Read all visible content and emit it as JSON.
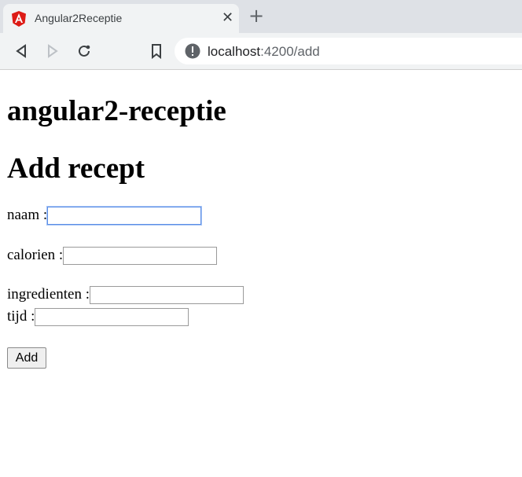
{
  "browser": {
    "tab_title": "Angular2Receptie",
    "url_host": "localhost",
    "url_path": ":4200/add"
  },
  "page": {
    "app_title": "angular2-receptie",
    "heading": "Add recept",
    "fields": [
      {
        "label": "naam :",
        "value": ""
      },
      {
        "label": "calorien :",
        "value": ""
      },
      {
        "label": "ingredienten :",
        "value": ""
      },
      {
        "label": "tijd :",
        "value": ""
      }
    ],
    "add_label": "Add"
  }
}
